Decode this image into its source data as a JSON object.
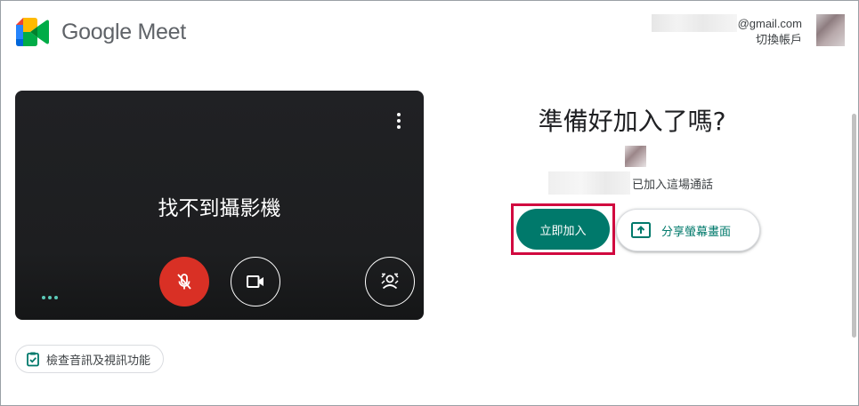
{
  "header": {
    "app_name": "Google Meet",
    "account_email_suffix": "@gmail.com",
    "switch_account": "切換帳戶"
  },
  "preview": {
    "message": "找不到攝影機",
    "more_options_icon": "more-vert-icon",
    "mic_icon": "mic-off-icon",
    "camera_icon": "videocam-icon",
    "effects_icon": "visual-effects-icon"
  },
  "check_av": {
    "label": "檢查音訊及視訊功能"
  },
  "join_panel": {
    "title": "準備好加入了嗎?",
    "joined_text": "已加入這場通話",
    "join_button": "立即加入",
    "share_button": "分享螢幕畫面"
  },
  "colors": {
    "join": "#00796b",
    "mic_off": "#d93025",
    "highlight": "#d1083f"
  }
}
